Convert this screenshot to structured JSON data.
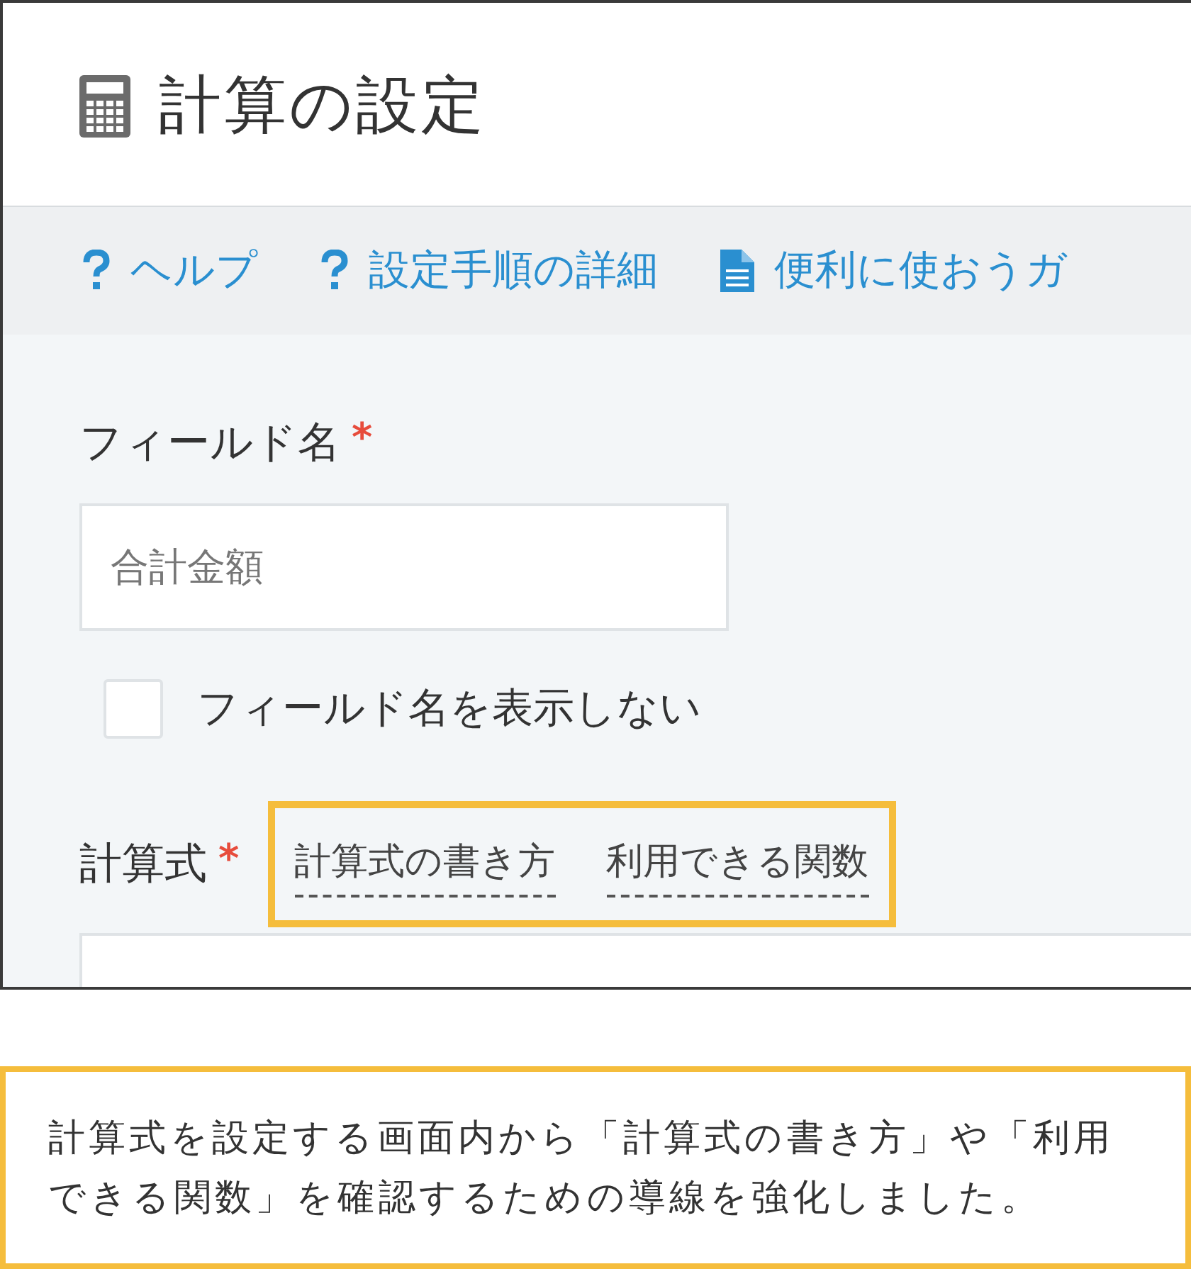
{
  "header": {
    "title": "計算の設定"
  },
  "toolbar": {
    "links": [
      {
        "kind": "help",
        "label": "ヘルプ"
      },
      {
        "kind": "help",
        "label": "設定手順の詳細"
      },
      {
        "kind": "document",
        "label": "便利に使おうガ"
      }
    ]
  },
  "form": {
    "field_name": {
      "label": "フィールド名",
      "required_mark": "*",
      "value": "合計金額"
    },
    "hide_label": {
      "label": "フィールド名を表示しない",
      "checked": false
    },
    "formula": {
      "label": "計算式",
      "required_mark": "*",
      "highlighted": true,
      "links": [
        "計算式の書き方",
        "利用できる関数"
      ]
    }
  },
  "caption": "計算式を設定する画面内から「計算式の書き方」や「利用できる関数」を確認するための導線を強化しました。"
}
